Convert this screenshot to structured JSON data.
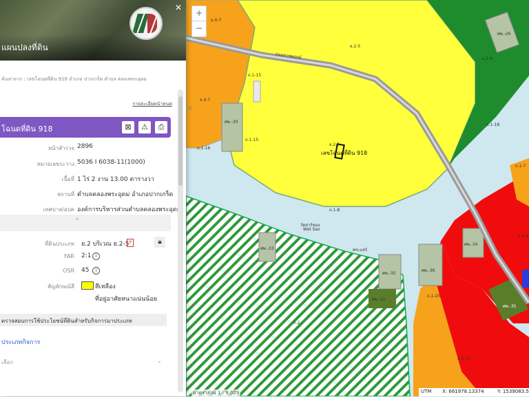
{
  "panel": {
    "top_title": "แผนปลงที่ดิน",
    "breadcrumb": "ค้นหาจาก : เลขโฉนดที่ดิน 918 อำเภอ ปากเกร็ด ตำบล คลองพระอุดม",
    "report_link": "รายละเอียดนำหนด",
    "header_title": "โฉนดที่ดิน 918",
    "header_icons": [
      "zoom-area-icon",
      "warning-icon",
      "print-icon"
    ],
    "details": [
      {
        "label": "หน้าสำรวจ",
        "value": "2896"
      },
      {
        "label": "หมายเลขระวาง",
        "value": "5036 I 6038-11(1000)"
      },
      {
        "label": "เนื้อที่",
        "value": "1 ไร่ 2 งาน 13.00 ตารางวา"
      },
      {
        "label": "สถานที่",
        "value": "ตำบลคลองพระอุดม อำเภอปากเกร็ด"
      },
      {
        "label": "เทศบาล/อบต",
        "value": "องค์การบริหารส่วนตำบลคลองพระอุดม"
      }
    ],
    "zoning": [
      {
        "label": "ที่ดินประเภท",
        "value": "ย.2 บริเวณ ย.2-5"
      },
      {
        "label": "FAR",
        "value": "2:1"
      },
      {
        "label": "OSR",
        "value": "45"
      },
      {
        "label": "สัญลักษณ์สี",
        "value": "สีเหลือง"
      }
    ],
    "zoning_desc": "ที่อยู่อาศัยหนาแน่นน้อย",
    "swatch_color": "#ffff00",
    "info_bar": "ตรวจสอบการใช้ประโยชน์ที่ดินสำหรับกิจการมาประเภท",
    "link_text": "ประเภทกิจการ",
    "select_placeholder": "เลือก"
  },
  "map": {
    "parcel_label": "เลขโฉนดที่ดิน 918",
    "labels": {
      "y2_5": "ย.2-5",
      "y4_7a": "ย.4-7",
      "y4_7b": "ย.4-7",
      "sw30": "ศพ.-30",
      "sw33": "ศพ.-33",
      "sw35": "ศพ.-35",
      "sw36": "ศพ.-36",
      "sw34": "ศพ.-34",
      "sw26": "ศพ.-26",
      "sw22": "ศพ.-22",
      "sw35b": "ศพ.-35",
      "k2": "ก.2",
      "y2_6": "ย.2-6",
      "y6_10": "ย.6-10",
      "r1_15": "ถ.1-15",
      "r1_18": "ถ.1-18",
      "r1_7": "ถ.1-7",
      "r1_20": "ถ.1-20",
      "r1_8": "ถ.1-8",
      "temple": "วัดสาร์ของ",
      "temple_en": "Wat Sao",
      "temple2": "พระแสร์",
      "road": "ถนนราชพฤกษ์",
      "y2_4": "ย.2-4",
      "r1_16": "ถ.1-16"
    },
    "colors": {
      "water": "#cfe7ee",
      "yellow": "#ffff3c",
      "orange": "#f7a21b",
      "green": "#1e8c2c",
      "red": "#f00c0c",
      "gray_green": "#b5c4a5",
      "hatch_green": "#2e9a3a",
      "olive": "#5a7d2b",
      "purple": "#7e57c2"
    }
  },
  "zoom": {
    "plus": "+",
    "minus": "−"
  },
  "scale_text": "มาตราส่วน 1 : 9,029",
  "coords": {
    "system": "UTM",
    "x": "X: 661978.13374",
    "y": "Y: 1539083.58"
  }
}
